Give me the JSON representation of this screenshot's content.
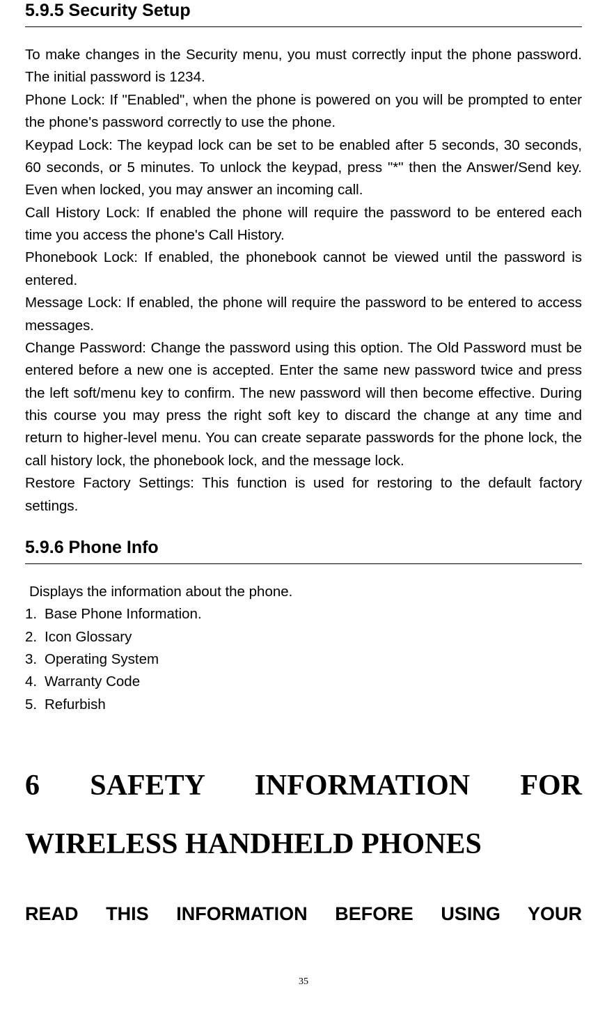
{
  "section595": {
    "heading": "5.9.5 Security Setup",
    "body": "To make changes in the Security menu, you must correctly input the phone password. The initial password is 1234.\nPhone Lock: If \"Enabled\", when the phone is powered on you will be prompted to enter the phone's password correctly to use the phone.\nKeypad Lock: The keypad lock can be set to be enabled after 5 seconds, 30 seconds, 60 seconds, or 5 minutes.  To unlock the keypad, press \"*\" then the Answer/Send key. Even when locked, you may answer an incoming call.\nCall History Lock: If enabled the phone will require the password to be entered each time you access the phone's Call History.\nPhonebook Lock: If enabled, the phonebook cannot be viewed until the password is entered.\nMessage Lock: If enabled, the phone will require the password to be entered to access messages.\nChange Password: Change the password using this option.   The Old Password must be entered before a new one is accepted. Enter the same new password twice and press the left soft/menu key to confirm. The new password will then become effective. During this course you may press the right soft key to discard the change at any time and return to higher-level menu. You can create separate passwords for the phone lock, the call history lock, the phonebook lock, and the message lock.\nRestore Factory Settings: This function is used for restoring to the default factory settings."
  },
  "section596": {
    "heading": "5.9.6 Phone Info",
    "intro": " Displays the information about the phone.",
    "items": [
      {
        "n": "1.",
        "label": "Base Phone Information."
      },
      {
        "n": "2.",
        "label": "Icon Glossary"
      },
      {
        "n": "3.",
        "label": "Operating System"
      },
      {
        "n": "4.",
        "label": "Warranty Code"
      },
      {
        "n": "5.",
        "label": "Refurbish"
      }
    ]
  },
  "chapter6": {
    "line1": "6 SAFETY INFORMATION FOR",
    "line2": "WIRELESS HANDHELD PHONES"
  },
  "subhead": "READ THIS INFORMATION BEFORE USING YOUR",
  "pageNumber": "35"
}
